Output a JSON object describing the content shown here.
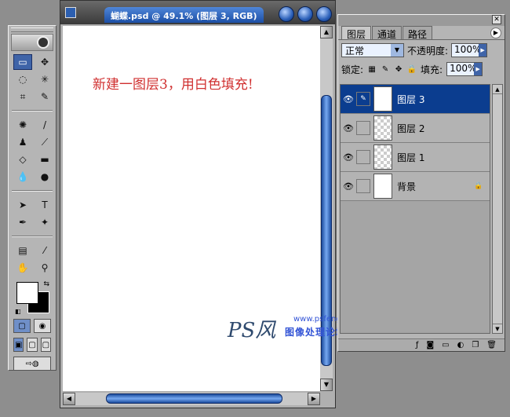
{
  "document": {
    "title": "蝴蝶.psd @ 49.1% (图层 3, RGB)",
    "caption": "新建一图层3，用白色填充!",
    "watermark_logo": "PS风",
    "watermark_url": "www.psfeng.cn",
    "watermark_forum": "图像处理论坛"
  },
  "layers_panel": {
    "tabs": [
      "图层",
      "通道",
      "路径"
    ],
    "blend_mode": "正常",
    "opacity_label": "不透明度:",
    "opacity_value": "100%",
    "lock_label": "锁定:",
    "fill_label": "填充:",
    "fill_value": "100%",
    "layers": [
      {
        "name": "图层 3",
        "selected": true
      },
      {
        "name": "图层 2",
        "selected": false
      },
      {
        "name": "图层 1",
        "selected": false
      },
      {
        "name": "背景",
        "selected": false
      }
    ]
  },
  "colors": {
    "accent": "#0b3d8f",
    "caption": "#d03030",
    "watermark": "#3354d6"
  }
}
